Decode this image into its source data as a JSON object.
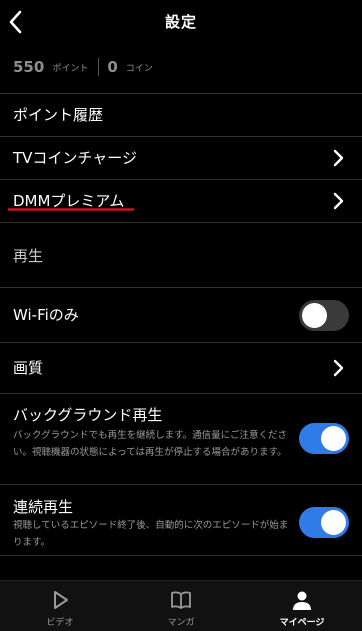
{
  "header": {
    "title": "設定"
  },
  "points": {
    "point_value": "550",
    "point_label": "ポイント",
    "coin_value": "0",
    "coin_label": "コイン"
  },
  "menu": {
    "point_history": "ポイント履歴",
    "tv_coin_charge": "TVコインチャージ",
    "dmm_premium": "DMMプレミアム"
  },
  "playback": {
    "section_title": "再生",
    "wifi_only": {
      "label": "Wi-Fiのみ",
      "enabled": false
    },
    "quality": {
      "label": "画質"
    },
    "background_play": {
      "label": "バックグラウンド再生",
      "description": "バックグラウンドでも再生を継続します。通信量にご注意ください。視聴機器の状態によっては再生が停止する場合があります。",
      "enabled": true
    },
    "continuous_play": {
      "label": "連続再生",
      "description": "視聴しているエピソード終了後、自動的に次のエピソードが始まります。",
      "enabled": true
    }
  },
  "tabs": [
    {
      "label": "ビデオ",
      "icon": "play-icon",
      "active": false
    },
    {
      "label": "マンガ",
      "icon": "book-icon",
      "active": false
    },
    {
      "label": "マイページ",
      "icon": "person-icon",
      "active": true
    }
  ],
  "colors": {
    "background": "#000000",
    "toggle_on": "#2f7be7",
    "underline_annotation": "#d0102a"
  }
}
